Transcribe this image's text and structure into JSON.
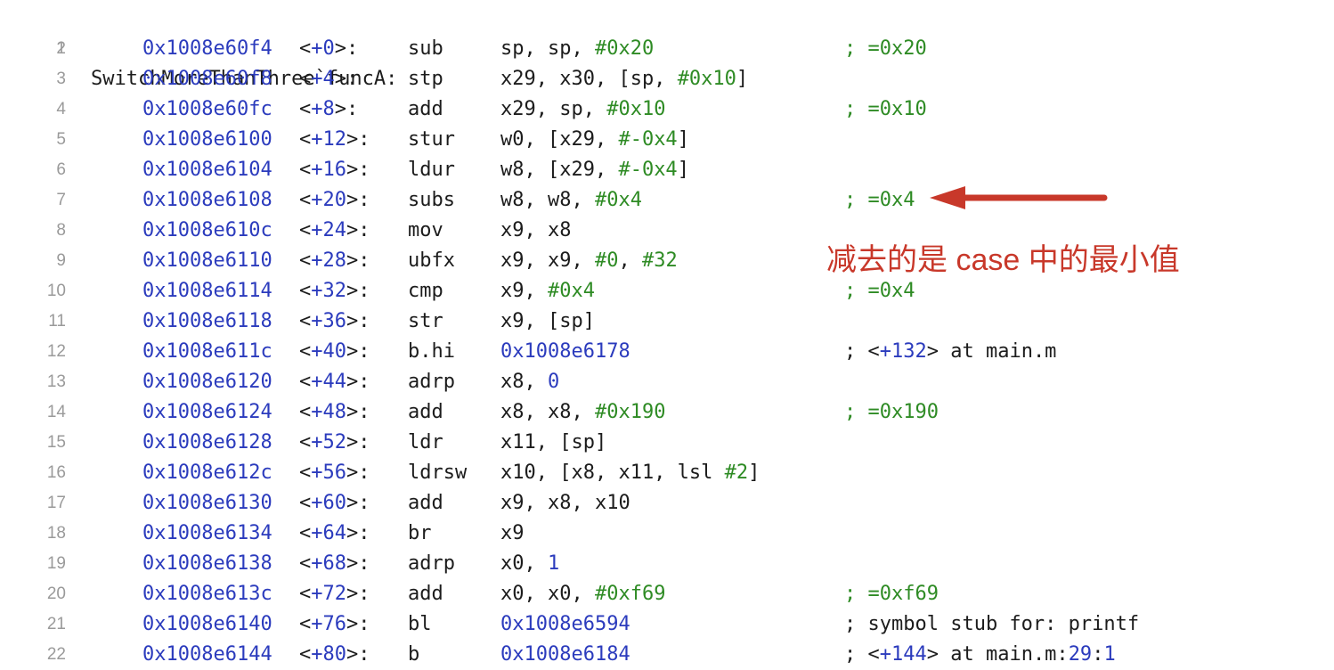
{
  "header": {
    "line_number": "1",
    "label": "SwitchMoreThanThree`funcA:"
  },
  "lines": [
    {
      "n": "2",
      "addr": "0x1008e60f4",
      "off": "+0",
      "mnem": "sub",
      "ops": [
        [
          "sp, sp, ",
          "plain"
        ],
        [
          "#0x20",
          "imm"
        ]
      ],
      "cmt": [
        [
          "; =0x20",
          "cmt"
        ]
      ]
    },
    {
      "n": "3",
      "addr": "0x1008e60f8",
      "off": "+4",
      "mnem": "stp",
      "ops": [
        [
          "x29, x30, [sp, ",
          "plain"
        ],
        [
          "#0x10",
          "imm"
        ],
        [
          "]",
          "plain"
        ]
      ],
      "cmt": []
    },
    {
      "n": "4",
      "addr": "0x1008e60fc",
      "off": "+8",
      "mnem": "add",
      "ops": [
        [
          "x29, sp, ",
          "plain"
        ],
        [
          "#0x10",
          "imm"
        ]
      ],
      "cmt": [
        [
          "; =0x10",
          "cmt"
        ]
      ]
    },
    {
      "n": "5",
      "addr": "0x1008e6100",
      "off": "+12",
      "mnem": "stur",
      "ops": [
        [
          "w0, [x29, ",
          "plain"
        ],
        [
          "#-0x4",
          "imm"
        ],
        [
          "]",
          "plain"
        ]
      ],
      "cmt": []
    },
    {
      "n": "6",
      "addr": "0x1008e6104",
      "off": "+16",
      "mnem": "ldur",
      "ops": [
        [
          "w8, [x29, ",
          "plain"
        ],
        [
          "#-0x4",
          "imm"
        ],
        [
          "]",
          "plain"
        ]
      ],
      "cmt": []
    },
    {
      "n": "7",
      "addr": "0x1008e6108",
      "off": "+20",
      "mnem": "subs",
      "ops": [
        [
          "w8, w8, ",
          "plain"
        ],
        [
          "#0x4",
          "imm"
        ]
      ],
      "cmt": [
        [
          "; =0x4",
          "cmt"
        ]
      ]
    },
    {
      "n": "8",
      "addr": "0x1008e610c",
      "off": "+24",
      "mnem": "mov",
      "ops": [
        [
          "x9, x8",
          "plain"
        ]
      ],
      "cmt": []
    },
    {
      "n": "9",
      "addr": "0x1008e6110",
      "off": "+28",
      "mnem": "ubfx",
      "ops": [
        [
          "x9, x9, ",
          "plain"
        ],
        [
          "#0",
          "imm"
        ],
        [
          ", ",
          "plain"
        ],
        [
          "#32",
          "imm"
        ]
      ],
      "cmt": []
    },
    {
      "n": "10",
      "addr": "0x1008e6114",
      "off": "+32",
      "mnem": "cmp",
      "ops": [
        [
          "x9, ",
          "plain"
        ],
        [
          "#0x4",
          "imm"
        ]
      ],
      "cmt": [
        [
          "; =0x4",
          "cmt"
        ]
      ]
    },
    {
      "n": "11",
      "addr": "0x1008e6118",
      "off": "+36",
      "mnem": "str",
      "ops": [
        [
          "x9, [sp]",
          "plain"
        ]
      ],
      "cmt": []
    },
    {
      "n": "12",
      "addr": "0x1008e611c",
      "off": "+40",
      "mnem": "b.hi",
      "ops": [
        [
          "0x1008e6178",
          "blue"
        ]
      ],
      "cmt": [
        [
          "; <",
          "plain"
        ],
        [
          "+132",
          "blue"
        ],
        [
          "> at main.m",
          "plain"
        ]
      ]
    },
    {
      "n": "13",
      "addr": "0x1008e6120",
      "off": "+44",
      "mnem": "adrp",
      "ops": [
        [
          "x8, ",
          "plain"
        ],
        [
          "0",
          "blue"
        ]
      ],
      "cmt": []
    },
    {
      "n": "14",
      "addr": "0x1008e6124",
      "off": "+48",
      "mnem": "add",
      "ops": [
        [
          "x8, x8, ",
          "plain"
        ],
        [
          "#0x190",
          "imm"
        ]
      ],
      "cmt": [
        [
          "; =0x190",
          "cmt"
        ]
      ]
    },
    {
      "n": "15",
      "addr": "0x1008e6128",
      "off": "+52",
      "mnem": "ldr",
      "ops": [
        [
          "x11, [sp]",
          "plain"
        ]
      ],
      "cmt": []
    },
    {
      "n": "16",
      "addr": "0x1008e612c",
      "off": "+56",
      "mnem": "ldrsw",
      "ops": [
        [
          "x10, [x8, x11, lsl ",
          "plain"
        ],
        [
          "#2",
          "imm"
        ],
        [
          "]",
          "plain"
        ]
      ],
      "cmt": []
    },
    {
      "n": "17",
      "addr": "0x1008e6130",
      "off": "+60",
      "mnem": "add",
      "ops": [
        [
          "x9, x8, x10",
          "plain"
        ]
      ],
      "cmt": []
    },
    {
      "n": "18",
      "addr": "0x1008e6134",
      "off": "+64",
      "mnem": "br",
      "ops": [
        [
          "x9",
          "plain"
        ]
      ],
      "cmt": []
    },
    {
      "n": "19",
      "addr": "0x1008e6138",
      "off": "+68",
      "mnem": "adrp",
      "ops": [
        [
          "x0, ",
          "plain"
        ],
        [
          "1",
          "blue"
        ]
      ],
      "cmt": []
    },
    {
      "n": "20",
      "addr": "0x1008e613c",
      "off": "+72",
      "mnem": "add",
      "ops": [
        [
          "x0, x0, ",
          "plain"
        ],
        [
          "#0xf69",
          "imm"
        ]
      ],
      "cmt": [
        [
          "; =0xf69",
          "cmt"
        ]
      ]
    },
    {
      "n": "21",
      "addr": "0x1008e6140",
      "off": "+76",
      "mnem": "bl",
      "ops": [
        [
          "0x1008e6594",
          "blue"
        ]
      ],
      "cmt": [
        [
          "; symbol stub for: printf",
          "plain"
        ]
      ]
    },
    {
      "n": "22",
      "addr": "0x1008e6144",
      "off": "+80",
      "mnem": "b",
      "ops": [
        [
          "0x1008e6184",
          "blue"
        ]
      ],
      "cmt": [
        [
          "; <",
          "plain"
        ],
        [
          "+144",
          "blue"
        ],
        [
          "> at main.m:",
          "plain"
        ],
        [
          "29",
          "blue"
        ],
        [
          ":",
          "plain"
        ],
        [
          "1",
          "blue"
        ]
      ]
    }
  ],
  "annotation": {
    "text": "减去的是 case 中的最小值",
    "color": "#c8382a",
    "arrow_target_line": "7"
  }
}
